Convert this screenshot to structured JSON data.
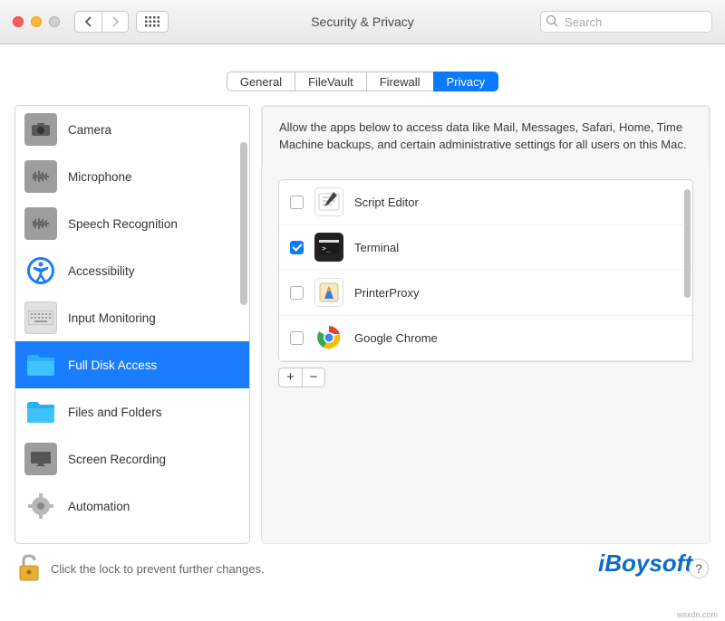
{
  "window": {
    "title": "Security & Privacy",
    "search_placeholder": "Search"
  },
  "tabs": [
    {
      "label": "General",
      "active": false
    },
    {
      "label": "FileVault",
      "active": false
    },
    {
      "label": "Firewall",
      "active": false
    },
    {
      "label": "Privacy",
      "active": true
    }
  ],
  "sidebar": {
    "items": [
      {
        "label": "Camera",
        "icon": "camera"
      },
      {
        "label": "Microphone",
        "icon": "mic"
      },
      {
        "label": "Speech Recognition",
        "icon": "mic"
      },
      {
        "label": "Accessibility",
        "icon": "accessibility"
      },
      {
        "label": "Input Monitoring",
        "icon": "keyboard"
      },
      {
        "label": "Full Disk Access",
        "icon": "folder"
      },
      {
        "label": "Files and Folders",
        "icon": "folder"
      },
      {
        "label": "Screen Recording",
        "icon": "display"
      },
      {
        "label": "Automation",
        "icon": "gear"
      }
    ],
    "selected_index": 5
  },
  "description": "Allow the apps below to access data like Mail, Messages, Safari, Home, Time Machine backups, and certain administrative settings for all users on this Mac.",
  "apps": [
    {
      "label": "Script Editor",
      "checked": false,
      "icon": "script"
    },
    {
      "label": "Terminal",
      "checked": true,
      "icon": "terminal"
    },
    {
      "label": "PrinterProxy",
      "checked": false,
      "icon": "app"
    },
    {
      "label": "Google Chrome",
      "checked": false,
      "icon": "chrome"
    }
  ],
  "buttons": {
    "add": "+",
    "remove": "−",
    "help": "?"
  },
  "footer": {
    "lock_text": "Click the lock to prevent further changes."
  },
  "branding": "iBoysoft",
  "watermark": "wsxdn.com"
}
